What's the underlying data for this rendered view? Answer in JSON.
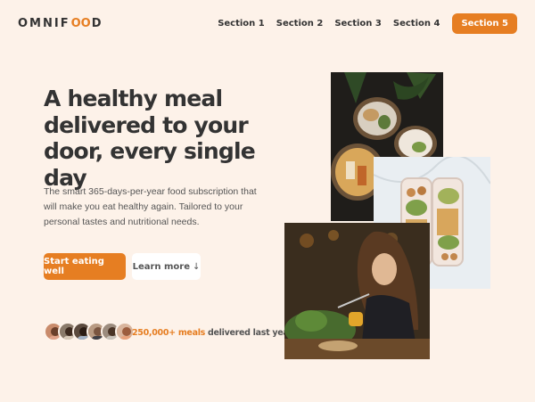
{
  "header": {
    "logo_prefix": "OMNIF",
    "logo_oo": "OO",
    "logo_suffix": "D",
    "nav": [
      "Section 1",
      "Section 2",
      "Section 3",
      "Section 4"
    ],
    "cta": "Section 5"
  },
  "hero": {
    "title": "A healthy meal delivered to your door, every single day",
    "description": "The smart 365-days-per-year food subscription that will make you eat healthy again. Tailored to your personal tastes and nutritional needs.",
    "primary_button": "Start eating well",
    "secondary_button": "Learn more",
    "secondary_arrow": "↓"
  },
  "delivered": {
    "count": "250,000+ meals",
    "text": " delivered last year!"
  },
  "colors": {
    "accent": "#e67e22",
    "background": "#fdf2e9"
  },
  "photos": [
    "food-bowls-photo",
    "meal-prep-containers-photo",
    "woman-eating-photo"
  ]
}
